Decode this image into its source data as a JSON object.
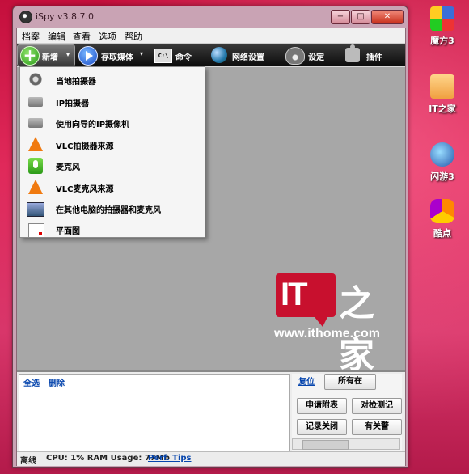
{
  "window": {
    "title": "iSpy v3.8.7.0",
    "controls": [
      "−",
      "□",
      "✕"
    ]
  },
  "menubar": [
    "档案",
    "编辑",
    "查看",
    "选项",
    "帮助"
  ],
  "toolbar": {
    "new_label": "新增",
    "save_media_label": "存取媒体",
    "command_label": "命令",
    "network_label": "网络设置",
    "settings_label": "设定",
    "plugins_label": "插件",
    "command_icon_text": "C:\\"
  },
  "dropdown": {
    "items": [
      {
        "label": "当地拍摄器",
        "icon": "webcam-icon"
      },
      {
        "label": "IP拍摄器",
        "icon": "ip-camera-icon"
      },
      {
        "label": "使用向导的IP摄像机",
        "icon": "ip-camera-wizard-icon"
      },
      {
        "label": "VLC拍摄器来源",
        "icon": "vlc-icon"
      },
      {
        "label": "麦克风",
        "icon": "microphone-icon"
      },
      {
        "label": "VLC麦克风来源",
        "icon": "vlc-icon"
      },
      {
        "label": "在其他电脑的拍摄器和麦克风",
        "icon": "remote-computer-icon"
      },
      {
        "label": "平面图",
        "icon": "floorplan-icon"
      }
    ]
  },
  "watermark": {
    "logo": "IT",
    "chinese": "之家",
    "url": "www.ithome.com"
  },
  "bottom": {
    "select_all": "全选",
    "delete": "删除",
    "reset_tab": "复位",
    "all_tab": "所有在",
    "buttons": [
      "申请附表",
      "对检测记",
      "记录关闭",
      "有关警"
    ]
  },
  "status": {
    "state": "离线",
    "usage": "CPU: 1% RAM Usage: 77Mb",
    "perf_tips": "Perf. Tips"
  },
  "desktop": {
    "icons": [
      {
        "label": "魔方3",
        "icon": "rubiks-cube-icon"
      },
      {
        "label": "IT之家",
        "icon": "ithome-icon"
      },
      {
        "label": "闪游3",
        "icon": "flash-game-icon"
      },
      {
        "label": "酷点",
        "icon": "hexagon-icon"
      }
    ]
  }
}
